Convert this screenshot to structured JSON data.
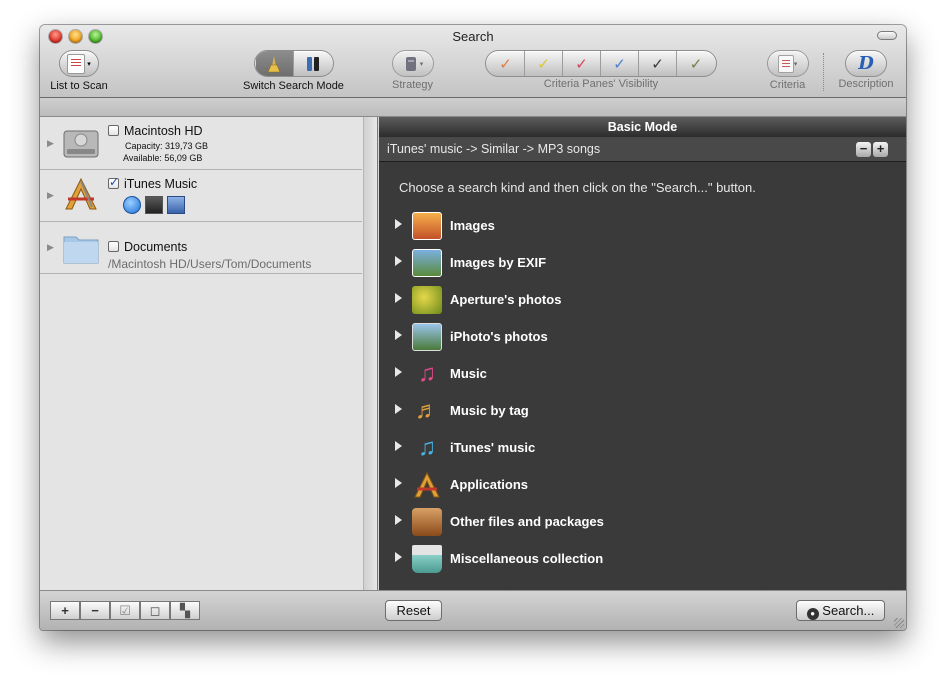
{
  "window": {
    "title": "Search"
  },
  "toolbar": {
    "list_to_scan": "List to Scan",
    "switch_search_mode": "Switch Search Mode",
    "strategy": "Strategy",
    "criteria_panes_visibility": "Criteria Panes' Visibility",
    "criteria": "Criteria",
    "description": "Description",
    "description_glyph": "D",
    "visibility_checks": [
      {
        "color": "#e07a4a"
      },
      {
        "color": "#d9c43a"
      },
      {
        "color": "#d8465a"
      },
      {
        "color": "#4a7fd6"
      },
      {
        "color": "#3a3a3a"
      },
      {
        "color": "#7a7a4a"
      }
    ]
  },
  "sidebar": {
    "volumes": [
      {
        "name": "Macintosh HD",
        "capacity": "Capacity: 319,73 GB",
        "available": "Available: 56,09 GB",
        "checked": false,
        "icon": "hard-disk-icon"
      },
      {
        "name": "iTunes Music",
        "checked": true,
        "icon": "applications-icon"
      },
      {
        "name": "Documents",
        "path": "/Macintosh HD/Users/Tom/Documents",
        "checked": false,
        "icon": "folder-icon"
      }
    ]
  },
  "main": {
    "mode_title": "Basic Mode",
    "breadcrumb": "iTunes' music -> Similar -> MP3 songs",
    "minus_label": "−",
    "plus_label": "+",
    "hint": "Choose a search kind and then click on the \"Search...\" button.",
    "kinds": [
      {
        "label": "Images",
        "icon": "images-icon"
      },
      {
        "label": "Images by EXIF",
        "icon": "exif-images-icon"
      },
      {
        "label": "Aperture's photos",
        "icon": "aperture-icon"
      },
      {
        "label": "iPhoto's photos",
        "icon": "iphoto-icon"
      },
      {
        "label": "Music",
        "icon": "music-notes-icon"
      },
      {
        "label": "Music by tag",
        "icon": "music-tag-icon"
      },
      {
        "label": "iTunes' music",
        "icon": "itunes-music-icon"
      },
      {
        "label": "Applications",
        "icon": "applications-icon"
      },
      {
        "label": "Other files and packages",
        "icon": "packages-icon"
      },
      {
        "label": "Miscellaneous collection",
        "icon": "basket-icon"
      }
    ]
  },
  "bottom": {
    "add": "+",
    "remove": "−",
    "reset": "Reset",
    "search": "Search..."
  }
}
